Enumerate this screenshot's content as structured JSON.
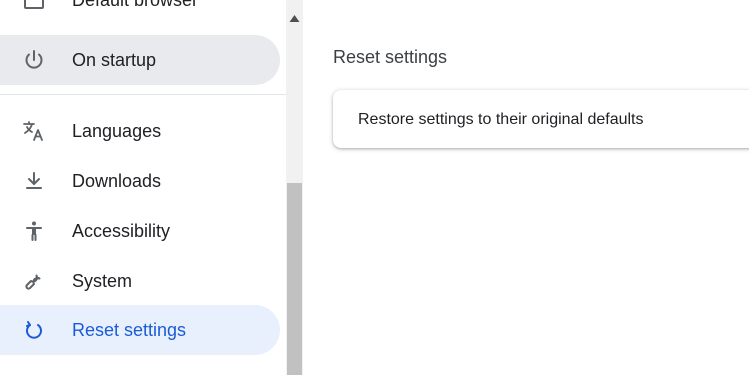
{
  "sidebar": {
    "items": [
      {
        "label": "Default browser",
        "icon": "browser-window-icon"
      },
      {
        "label": "On startup",
        "icon": "power-icon"
      },
      {
        "label": "Languages",
        "icon": "translate-icon"
      },
      {
        "label": "Downloads",
        "icon": "download-icon"
      },
      {
        "label": "Accessibility",
        "icon": "accessibility-icon"
      },
      {
        "label": "System",
        "icon": "wrench-icon"
      },
      {
        "label": "Reset settings",
        "icon": "reset-icon"
      }
    ],
    "selected": "Reset settings"
  },
  "main": {
    "section_title": "Reset settings",
    "card": {
      "row_label": "Restore settings to their original defaults"
    }
  },
  "colors": {
    "accent": "#1a5cd6",
    "selected_bg": "#e8f0fe",
    "hover_bg": "#e8eaed",
    "scrollbar_thumb": "#c1c1c1"
  }
}
